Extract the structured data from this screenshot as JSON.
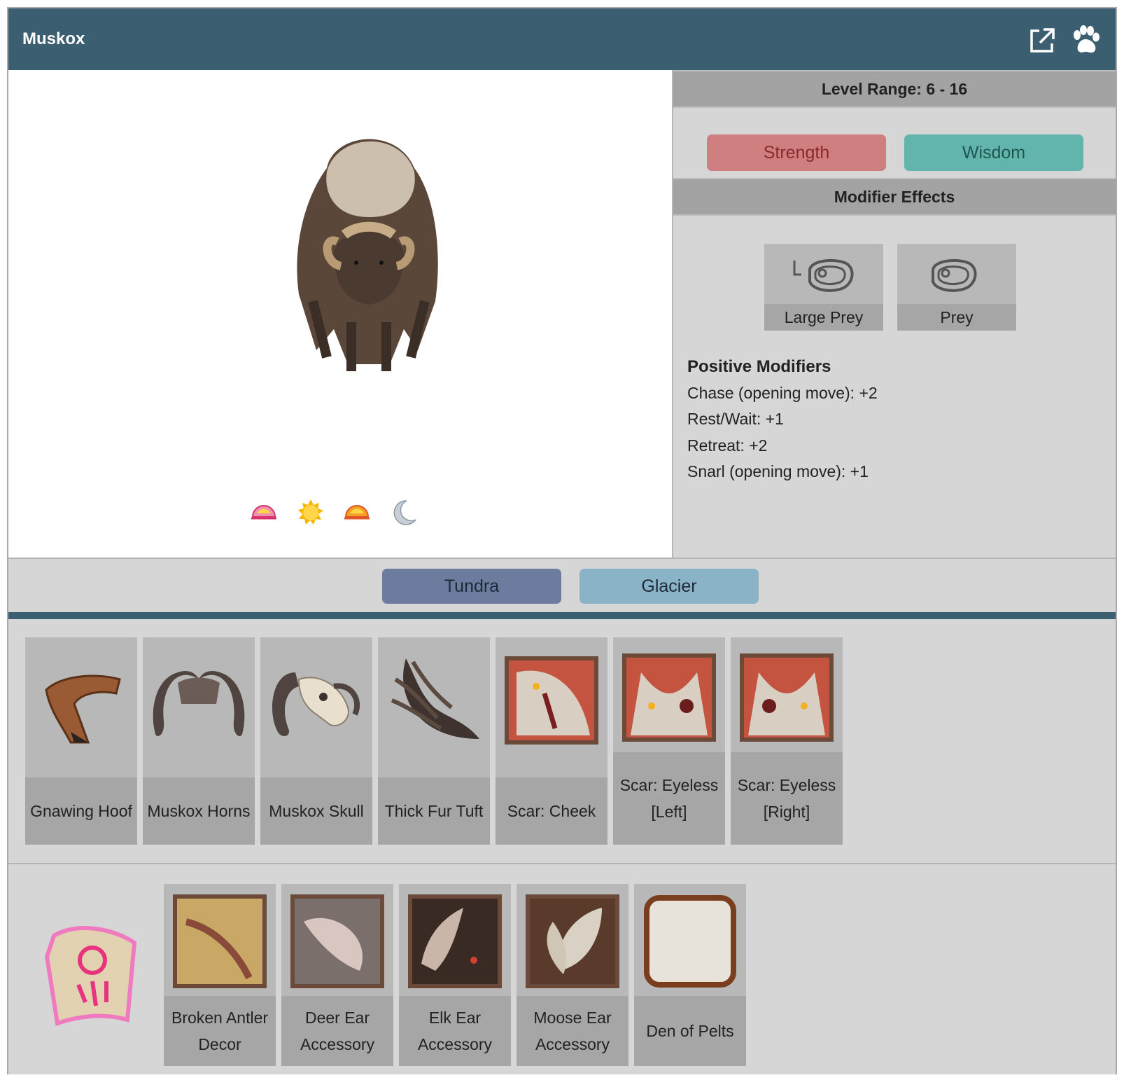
{
  "header": {
    "title": "Muskox",
    "external_icon": "external-link-icon",
    "paw_icon": "paw-icon"
  },
  "portrait": {
    "time_icons": [
      "dawn-icon",
      "day-icon",
      "dusk-icon",
      "night-icon"
    ]
  },
  "side": {
    "level_range": "Level Range: 6 - 16",
    "stats": {
      "strength": "Strength",
      "wisdom": "Wisdom"
    },
    "modifier_title": "Modifier Effects",
    "modifiers": [
      {
        "label": "Large Prey",
        "icon": "large-prey-icon"
      },
      {
        "label": "Prey",
        "icon": "prey-icon"
      }
    ],
    "positive_title": "Positive Modifiers",
    "positive": [
      "Chase (opening move): +2",
      "Rest/Wait: +1",
      "Retreat: +2",
      "Snarl (opening move): +1"
    ]
  },
  "biomes": {
    "tundra": "Tundra",
    "glacier": "Glacier"
  },
  "drops": [
    {
      "label": "Gnawing Hoof"
    },
    {
      "label": "Muskox Horns"
    },
    {
      "label": "Muskox Skull"
    },
    {
      "label": "Thick Fur Tuft"
    },
    {
      "label": "Scar: Cheek"
    },
    {
      "label": "Scar: Eyeless [Left]"
    },
    {
      "label": "Scar: Eyeless [Right]"
    }
  ],
  "rewards": [
    {
      "label": "Broken Antler Decor"
    },
    {
      "label": "Deer Ear Accessory"
    },
    {
      "label": "Elk Ear Accessory"
    },
    {
      "label": "Moose Ear Accessory"
    },
    {
      "label": "Den of Pelts"
    }
  ],
  "colors": {
    "header": "#3b5e70",
    "strength": "#cf7f80",
    "wisdom": "#62b5ad",
    "tundra": "#6c7b9e",
    "glacier": "#8ab3c7"
  }
}
